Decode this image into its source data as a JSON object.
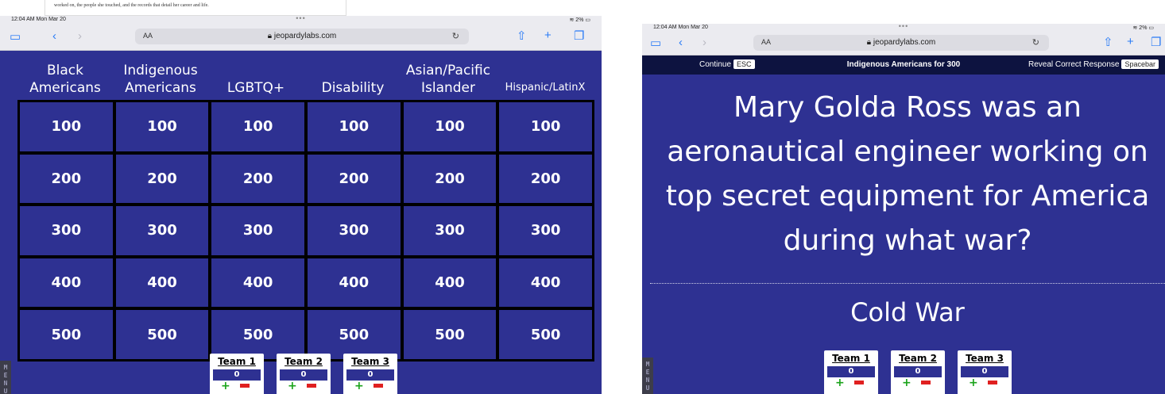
{
  "left": {
    "doc_text": "worked on, the people she touched, and the records that detail her career and life.",
    "status": {
      "time": "12:04 AM  Mon Mar 20",
      "dots": "•••",
      "battery": "2%"
    },
    "address": {
      "aa": "AA",
      "url": "jeopardylabs.com",
      "reload": "↻"
    },
    "categories": [
      "Black Americans",
      "Indigenous Americans",
      "LGBTQ+",
      "Disability",
      "Asian/Pacific Islander",
      "Hispanic/LatinX"
    ],
    "rows": [
      [
        "100",
        "100",
        "100",
        "100",
        "100",
        "100"
      ],
      [
        "200",
        "200",
        "200",
        "200",
        "200",
        "200"
      ],
      [
        "300",
        "300",
        "300",
        "300",
        "300",
        "300"
      ],
      [
        "400",
        "400",
        "400",
        "400",
        "400",
        "400"
      ],
      [
        "500",
        "500",
        "500",
        "500",
        "500",
        "500"
      ]
    ],
    "menu": "M E N U",
    "teams": [
      {
        "name": "Team 1",
        "score": "0",
        "plus": "+",
        "minus": "-"
      },
      {
        "name": "Team 2",
        "score": "0",
        "plus": "+",
        "minus": "-"
      },
      {
        "name": "Team 3",
        "score": "0",
        "plus": "+",
        "minus": "-"
      }
    ]
  },
  "right": {
    "status": {
      "time": "12:04 AM  Mon Mar 20",
      "dots": "•••",
      "battery": "2%"
    },
    "address": {
      "aa": "AA",
      "url": "jeopardylabs.com",
      "reload": "↻"
    },
    "clue_bar": {
      "continue_label": "Continue",
      "continue_key": "ESC",
      "title": "Indigenous Americans for 300",
      "reveal_label": "Reveal Correct Response",
      "reveal_key": "Spacebar"
    },
    "question": "Mary Golda Ross was an aeronautical engineer working on top secret equipment for America during what war?",
    "answer": "Cold War",
    "menu": "M E N U",
    "teams": [
      {
        "name": "Team 1",
        "score": "0",
        "plus": "+",
        "minus": "-"
      },
      {
        "name": "Team 2",
        "score": "0",
        "plus": "+",
        "minus": "-"
      },
      {
        "name": "Team 3",
        "score": "0",
        "plus": "+",
        "minus": "-"
      }
    ]
  },
  "colors": {
    "board_blue": "#2e3192",
    "grid_black": "#000000",
    "toolbar": "#ebebf0",
    "safari_blue": "#2b7cf6",
    "clue_bar": "#0d1340"
  },
  "icons": [
    "sidebar-icon",
    "back-icon",
    "forward-icon",
    "lock-icon",
    "reload-icon",
    "share-icon",
    "new-tab-icon",
    "tabs-icon",
    "wifi-icon",
    "battery-icon"
  ]
}
